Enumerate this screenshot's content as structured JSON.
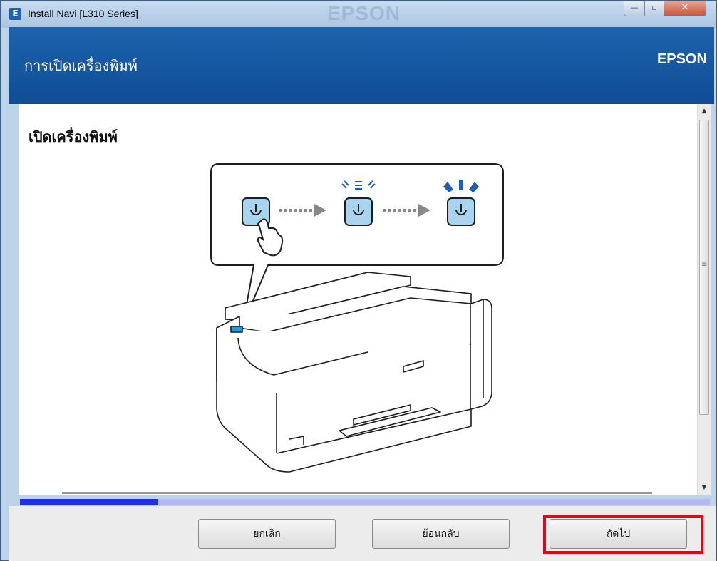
{
  "window": {
    "title": "Install Navi [L310 Series]",
    "watermark": "EPSON",
    "controls": {
      "minimize": "—",
      "maximize": "▫",
      "close": "✕"
    }
  },
  "header": {
    "title": "การเปิดเครื่องพิมพ์",
    "brand": "EPSON"
  },
  "main": {
    "heading": "เปิดเครื่องพิมพ์",
    "illustration": "printer-power-on-illustration"
  },
  "progress": {
    "fraction": 0.2
  },
  "footer": {
    "cancel_label": "ยกเลิก",
    "back_label": "ย้อนกลับ",
    "next_label": "ถัดไป"
  },
  "colors": {
    "header_bg": "#135aa3",
    "progress_fill": "#1f2fe9",
    "progress_track": "#b6b8f3",
    "highlight": "#e1061b",
    "power_button": "#a8d4f0"
  },
  "icons": [
    "app-icon",
    "power-icon",
    "hand-pointer-icon",
    "arrow-right-icon"
  ]
}
